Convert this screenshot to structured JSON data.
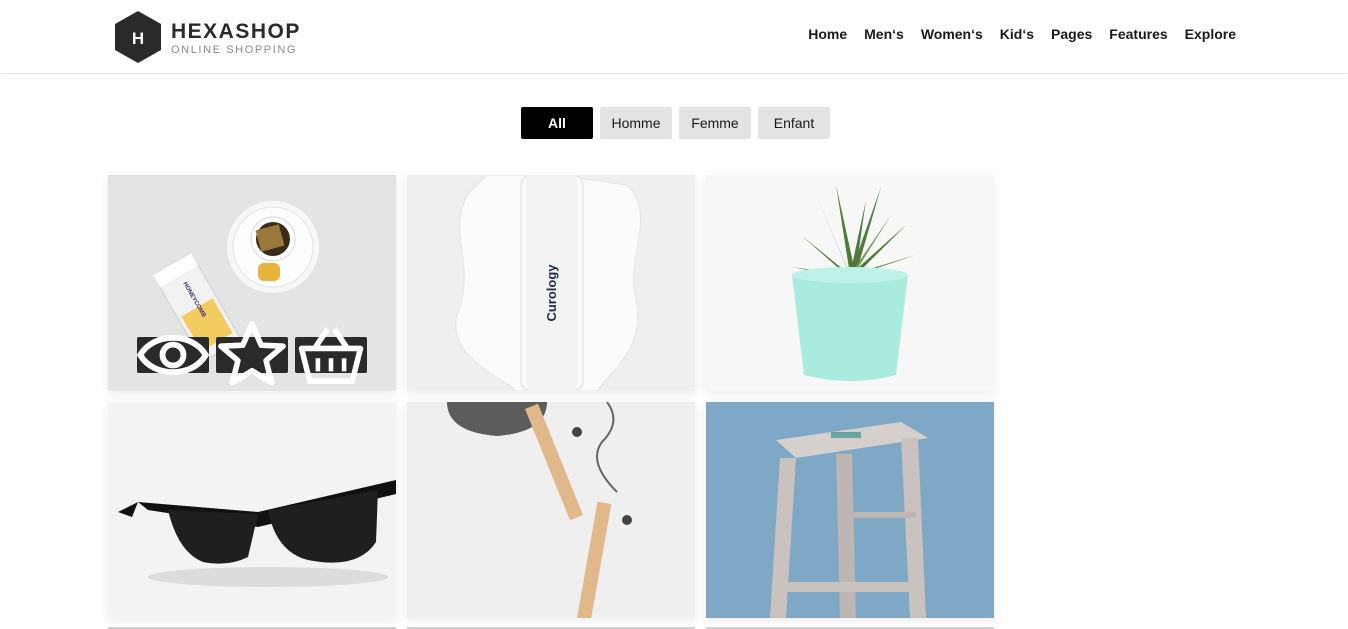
{
  "brand": {
    "title": "HEXASHOP",
    "subtitle": "ONLINE SHOPPING",
    "logo_letter": "H"
  },
  "nav": {
    "items": [
      {
        "label": "Home"
      },
      {
        "label": "Men‘s"
      },
      {
        "label": "Women‘s"
      },
      {
        "label": "Kid‘s"
      },
      {
        "label": "Pages"
      },
      {
        "label": "Features"
      },
      {
        "label": "Explore"
      }
    ]
  },
  "filters": {
    "items": [
      {
        "label": "All",
        "active": true
      },
      {
        "label": "Homme",
        "active": false
      },
      {
        "label": "Femme",
        "active": false
      },
      {
        "label": "Enfant",
        "active": false
      }
    ]
  },
  "products": [
    {
      "name": "honeycomb-tea",
      "bottle_label": "HONEYCOMB"
    },
    {
      "name": "curology-bottle",
      "bottle_label": "Curology"
    },
    {
      "name": "succulent-plant"
    },
    {
      "name": "sunglasses"
    },
    {
      "name": "desk-lamp"
    },
    {
      "name": "wooden-stool"
    }
  ],
  "card_actions": [
    {
      "icon": "eye-icon"
    },
    {
      "icon": "star-icon"
    },
    {
      "icon": "basket-icon"
    }
  ],
  "colors": {
    "accent": "#000000",
    "filter_bg": "#e3e3e6",
    "action_bg": "#2a2a2a",
    "stool_bg": "#7fa7c6"
  }
}
